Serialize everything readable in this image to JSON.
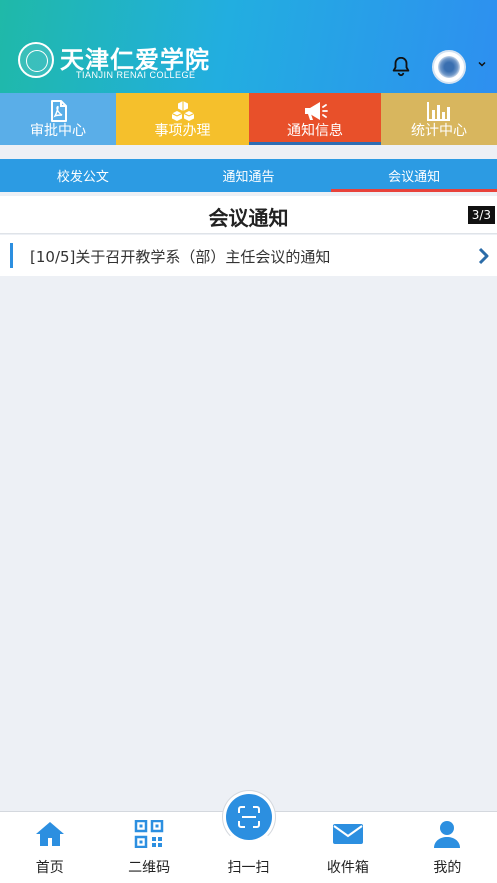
{
  "header": {
    "logo_cn": "天津仁爱学院",
    "logo_en": "TIANJIN RENAI COLLEGE"
  },
  "tiles": [
    {
      "label": "审批中心",
      "color": "#5aaee8",
      "icon": "pdf-document-icon"
    },
    {
      "label": "事项办理",
      "color": "#f5c02c",
      "icon": "cubes-icon"
    },
    {
      "label": "通知信息",
      "color": "#e8502a",
      "icon": "megaphone-icon"
    },
    {
      "label": "统计中心",
      "color": "#d8b65e",
      "icon": "bar-chart-icon"
    }
  ],
  "subtabs": [
    {
      "label": "校发公文"
    },
    {
      "label": "通知通告"
    },
    {
      "label": "会议通知"
    }
  ],
  "section": {
    "title": "会议通知",
    "page_indicator": "3/3"
  },
  "list": [
    {
      "text": "[10/5]关于召开教学系（部）主任会议的通知"
    }
  ],
  "bottom_nav": [
    {
      "label": "首页",
      "icon": "home-icon"
    },
    {
      "label": "二维码",
      "icon": "qr-code-icon"
    },
    {
      "label": "扫一扫",
      "icon": "scan-icon"
    },
    {
      "label": "收件箱",
      "icon": "envelope-icon"
    },
    {
      "label": "我的",
      "icon": "user-icon"
    }
  ],
  "colors": {
    "accent": "#2c8fe0",
    "subtab_bar": "#2c9be3",
    "active_underline": "#e8423a"
  }
}
